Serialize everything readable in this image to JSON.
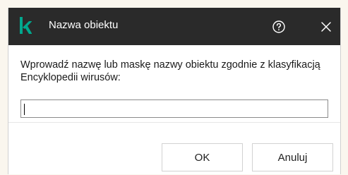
{
  "dialog": {
    "title": "Nazwa obiektu",
    "help_icon": "help-circle-icon",
    "close_icon": "close-icon",
    "prompt": "Wprowadź nazwę lub maskę nazwy obiektu zgodnie z klasyfikacją Encyklopedii wirusów:",
    "input_value": "",
    "ok_label": "OK",
    "cancel_label": "Anuluj"
  },
  "colors": {
    "titlebar": "#2a2a2a",
    "brand": "#00a88e"
  }
}
